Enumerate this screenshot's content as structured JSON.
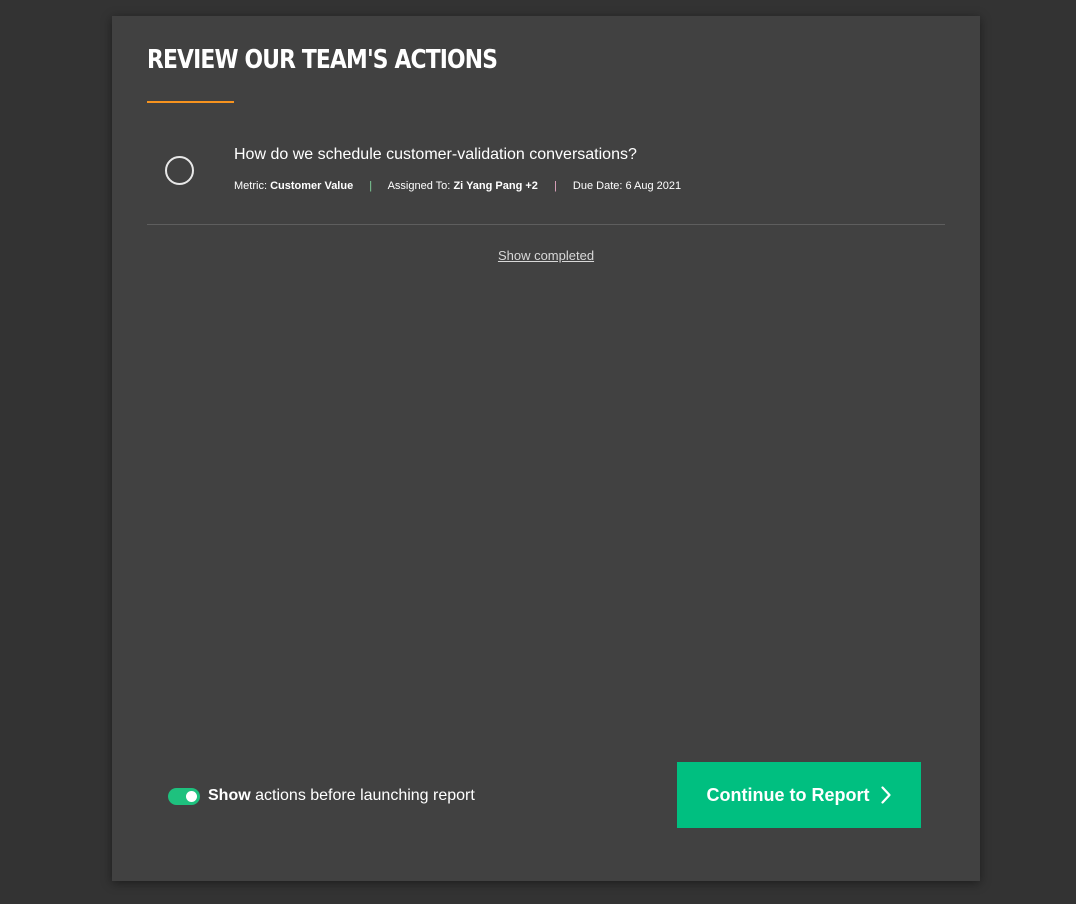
{
  "panel": {
    "title": "REVIEW OUR TEAM'S ACTIONS",
    "accent_color": "#f7931e"
  },
  "actions": [
    {
      "title": "How do we schedule customer-validation conversations?",
      "metric_label": "Metric:",
      "metric_value": "Customer Value",
      "assigned_label": "Assigned To:",
      "assigned_value": "Zi Yang Pang +2",
      "due_label": "Due Date:",
      "due_value": "6 Aug 2021",
      "separator": "|",
      "completed": false
    }
  ],
  "show_completed_label": "Show completed",
  "footer": {
    "toggle_on": true,
    "toggle_label_bold": "Show",
    "toggle_label_rest": " actions before launching report",
    "continue_label": "Continue to Report",
    "button_color": "#00bf80"
  },
  "icons": {
    "checkbox": "circle-checkbox-icon",
    "continue": "chevron-right-icon"
  }
}
